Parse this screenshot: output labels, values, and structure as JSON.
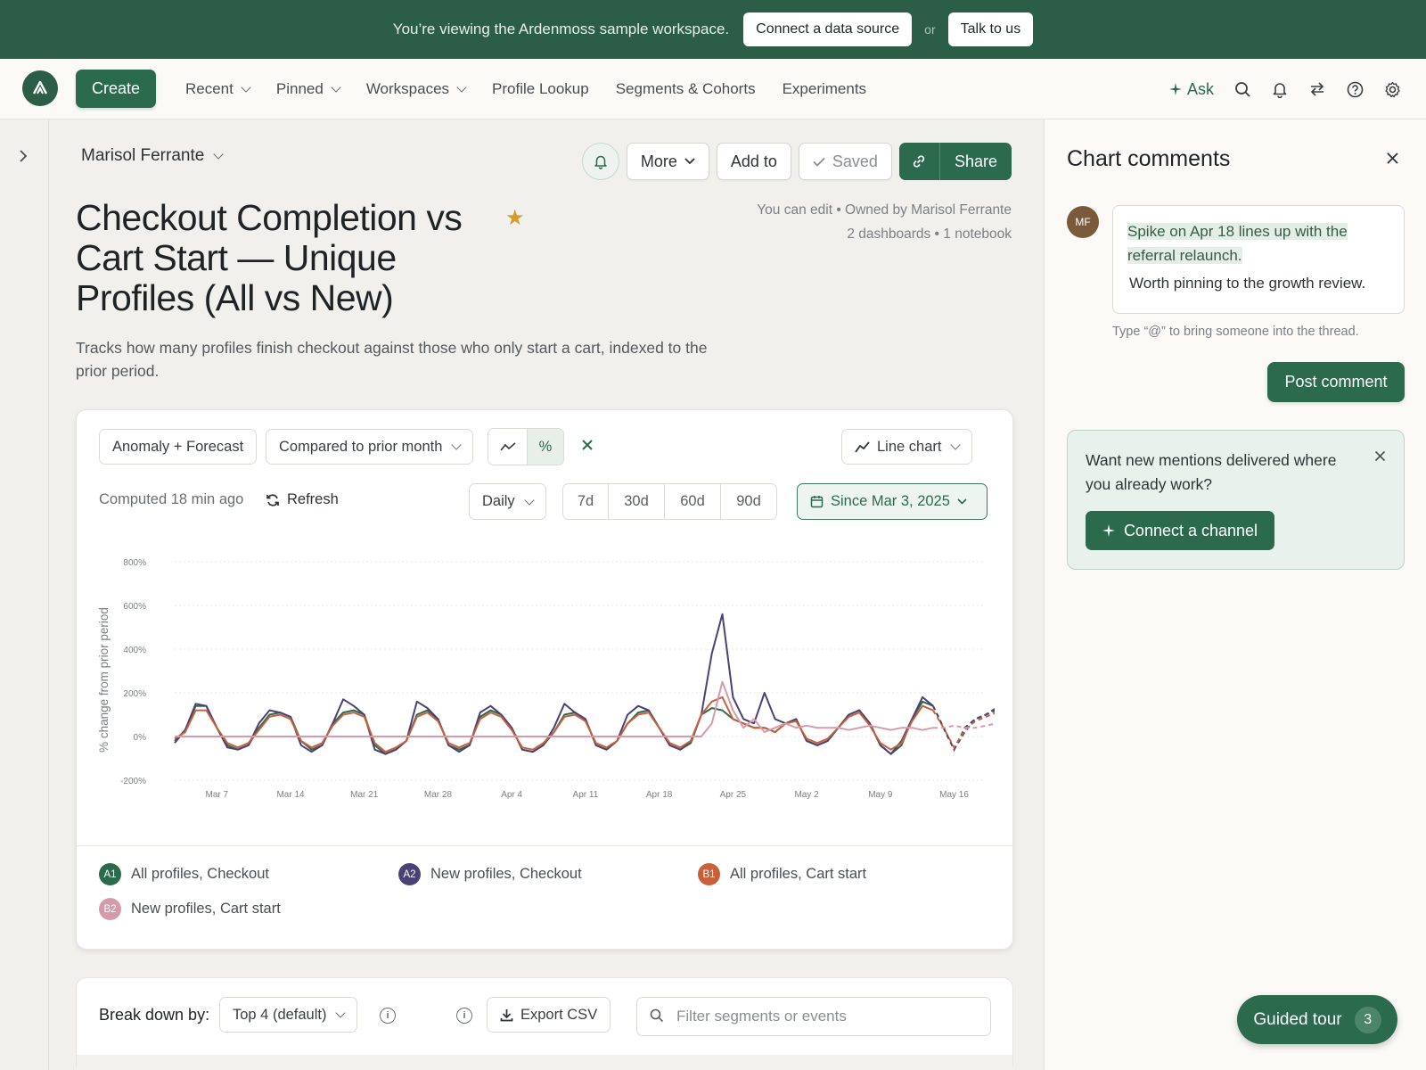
{
  "banner": {
    "text": "You’re viewing the Ardenmoss sample workspace.",
    "connect_label": "Connect a data source",
    "or_label": "or",
    "talk_label": "Talk to us"
  },
  "nav": {
    "create_label": "Create",
    "items": [
      "Recent",
      "Pinned",
      "Workspaces",
      "Profile Lookup",
      "Segments & Cohorts",
      "Experiments"
    ],
    "ask_label": "Ask"
  },
  "header": {
    "owner": "Marisol Ferrante",
    "title": "Checkout Completion vs Cart Start — Unique Profiles (All vs New)",
    "description": "Tracks how many profiles finish checkout against those who only start a cart, indexed to the prior period.",
    "meta_line1": "You can edit • Owned by Marisol Ferrante",
    "meta_line2": "2 dashboards • 1 notebook",
    "actions": {
      "more": "More",
      "add_to": "Add to",
      "saved": "Saved",
      "share": "Share"
    }
  },
  "controls": {
    "anomaly": "Anomaly + Forecast",
    "compare": "Compared to prior month",
    "percent": "%",
    "chart_type": "Line chart",
    "computed": "Computed 18 min ago",
    "refresh": "Refresh",
    "granularity": "Daily",
    "ranges": [
      "7d",
      "30d",
      "60d",
      "90d"
    ],
    "date": "Since Mar 3, 2025"
  },
  "legend": [
    {
      "badge": "A1",
      "label": "All profiles, Checkout",
      "color": "#2c6a4d"
    },
    {
      "badge": "A2",
      "label": "New profiles, Checkout",
      "color": "#4a4275"
    },
    {
      "badge": "B1",
      "label": "All profiles, Cart start",
      "color": "#c8603a"
    },
    {
      "badge": "B2",
      "label": "New profiles, Cart start",
      "color": "#d59aab"
    }
  ],
  "chart_data": {
    "type": "line",
    "ylabel": "% change from prior period",
    "ylim": [
      -200,
      800
    ],
    "yticks": [
      "800%",
      "600%",
      "400%",
      "200%",
      "0%",
      "-200%"
    ],
    "yticks_values": [
      800,
      600,
      400,
      200,
      0,
      -200
    ],
    "xticks": [
      "Mar 7",
      "Mar 14",
      "Mar 21",
      "Mar 28",
      "Apr 4",
      "Apr 11",
      "Apr 18",
      "Apr 25",
      "May 2",
      "May 9",
      "May 16"
    ],
    "x_start": "2025-03-03",
    "x_end": "2025-05-19",
    "forecast_start": "2025-05-14",
    "series": [
      {
        "name": "All profiles, Checkout",
        "color": "#2c6a4d",
        "values": [
          -20,
          30,
          140,
          140,
          40,
          -40,
          -60,
          -40,
          40,
          100,
          110,
          90,
          -20,
          -60,
          -40,
          60,
          110,
          120,
          100,
          -40,
          -80,
          -60,
          -20,
          100,
          120,
          80,
          -40,
          -60,
          -40,
          90,
          120,
          100,
          40,
          -60,
          -70,
          -40,
          20,
          100,
          110,
          80,
          -40,
          -60,
          -20,
          60,
          110,
          120,
          40,
          -40,
          -60,
          -30,
          100,
          130,
          120,
          80,
          60,
          40,
          40,
          20,
          60,
          80,
          -20,
          -40,
          -20,
          40,
          100,
          120,
          60,
          -40,
          -80,
          -40,
          80,
          160,
          140,
          40,
          -60,
          20,
          80,
          100,
          120,
          170,
          230,
          300
        ]
      },
      {
        "name": "New profiles, Checkout",
        "color": "#4a4275",
        "values": [
          -30,
          30,
          150,
          140,
          40,
          -50,
          -60,
          -40,
          60,
          120,
          110,
          90,
          -40,
          -70,
          -40,
          60,
          170,
          140,
          100,
          -60,
          -80,
          -60,
          -20,
          160,
          130,
          80,
          -40,
          -70,
          -40,
          110,
          140,
          100,
          40,
          -60,
          -70,
          -40,
          40,
          150,
          110,
          80,
          -40,
          -60,
          -20,
          100,
          140,
          120,
          40,
          -40,
          -60,
          -20,
          100,
          380,
          560,
          180,
          80,
          60,
          200,
          80,
          60,
          80,
          -20,
          -40,
          -20,
          40,
          100,
          120,
          60,
          -40,
          -80,
          -20,
          80,
          180,
          140,
          40,
          -60,
          40,
          80,
          100,
          130,
          200,
          270,
          330
        ]
      },
      {
        "name": "All profiles, Cart start",
        "color": "#c8603a",
        "values": [
          -10,
          20,
          120,
          120,
          40,
          -30,
          -50,
          -30,
          30,
          90,
          100,
          80,
          -20,
          -50,
          -30,
          50,
          100,
          110,
          90,
          -30,
          -70,
          -50,
          -20,
          90,
          110,
          70,
          -30,
          -50,
          -30,
          80,
          110,
          90,
          30,
          -50,
          -60,
          -30,
          20,
          90,
          100,
          70,
          -30,
          -50,
          -20,
          60,
          100,
          110,
          40,
          -30,
          -50,
          -20,
          100,
          160,
          180,
          80,
          60,
          40,
          40,
          20,
          60,
          70,
          -10,
          -30,
          -10,
          40,
          90,
          110,
          50,
          -30,
          -60,
          -30,
          70,
          140,
          120,
          40,
          -50,
          30,
          70,
          90,
          110,
          140,
          180,
          260
        ]
      },
      {
        "name": "New profiles, Cart start",
        "color": "#d59aab",
        "values": [
          0,
          0,
          0,
          0,
          0,
          0,
          0,
          0,
          0,
          0,
          0,
          0,
          0,
          0,
          0,
          0,
          0,
          0,
          0,
          0,
          0,
          0,
          0,
          0,
          0,
          0,
          0,
          0,
          0,
          0,
          0,
          0,
          0,
          0,
          0,
          0,
          0,
          0,
          0,
          0,
          0,
          0,
          0,
          0,
          0,
          0,
          0,
          0,
          0,
          0,
          0,
          60,
          250,
          120,
          40,
          80,
          20,
          40,
          60,
          40,
          50,
          40,
          40,
          40,
          30,
          40,
          50,
          40,
          30,
          40,
          40,
          30,
          40,
          40,
          50,
          40,
          40,
          50,
          60,
          70,
          90,
          100
        ]
      }
    ]
  },
  "breakdown": {
    "label": "Break down by:",
    "select": "Top 4 (default)",
    "export": "Export CSV",
    "filter_placeholder": "Filter segments or events"
  },
  "comments": {
    "title": "Chart comments",
    "avatar": "MF",
    "highlight": "Spike on Apr 18 lines up with the referral relaunch.",
    "body": "Worth pinning to the growth review.",
    "hint": "Type “@” to bring someone into the thread.",
    "post": "Post comment",
    "notice": "Want new mentions delivered where you already work?",
    "connect_channel": "Connect a channel"
  },
  "tour": {
    "label": "Guided tour",
    "count": "3"
  }
}
